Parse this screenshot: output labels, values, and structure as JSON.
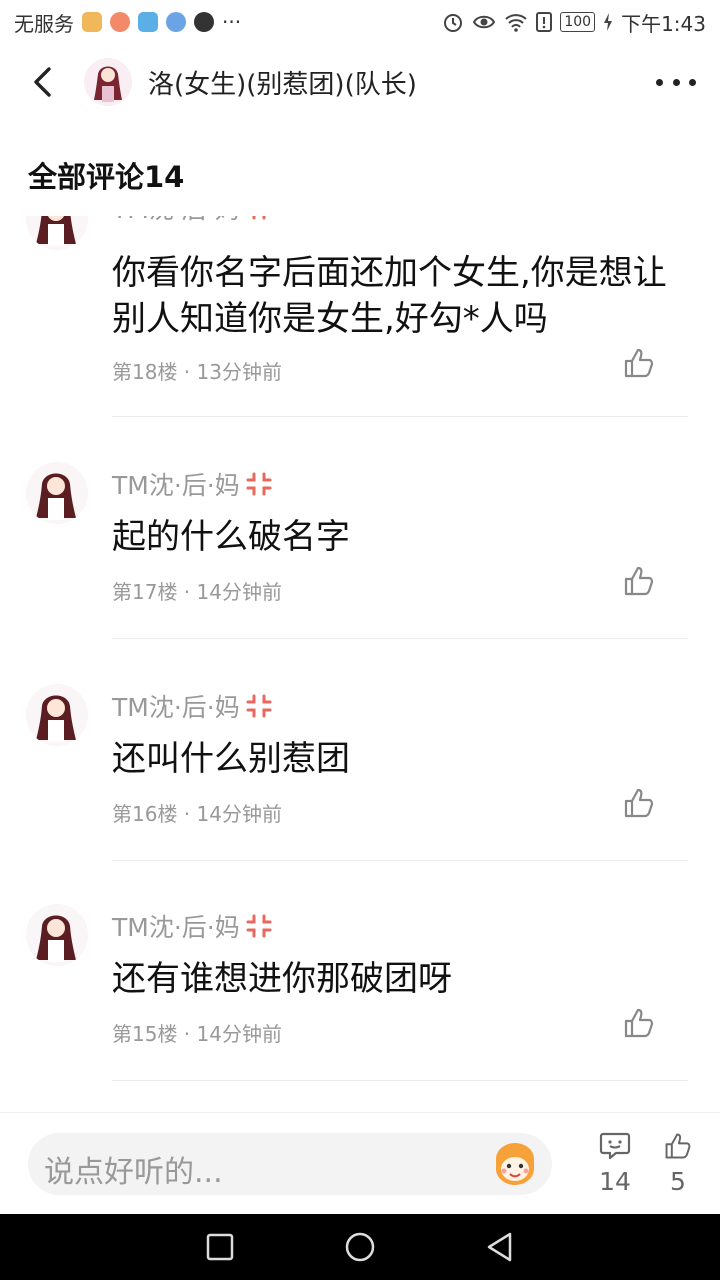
{
  "status_bar": {
    "left_text": "无服务",
    "more": "···",
    "battery": "100",
    "time": "下午1:43"
  },
  "header": {
    "title": "洛(女生)(别惹团)(队长)"
  },
  "section_title": "全部评论14",
  "comments": [
    {
      "user": "TM沈·后·妈",
      "text": "你看你名字后面还加个女生,你是想让别人知道你是女生,好勾*人吗",
      "meta": "第18楼 · 13分钟前"
    },
    {
      "user": "TM沈·后·妈",
      "text": "起的什么破名字",
      "meta": "第17楼 · 14分钟前"
    },
    {
      "user": "TM沈·后·妈",
      "text": "还叫什么别惹团",
      "meta": "第16楼 · 14分钟前"
    },
    {
      "user": "TM沈·后·妈",
      "text": "还有谁想进你那破团呀",
      "meta": "第15楼 · 14分钟前"
    }
  ],
  "bottom_bar": {
    "reply_placeholder": "说点好听的...",
    "comment_count": "14",
    "like_count": "5"
  },
  "colors": {
    "accent_gray": "#999999",
    "angry_red": "#e8685d",
    "nav_bg": "#000000"
  }
}
